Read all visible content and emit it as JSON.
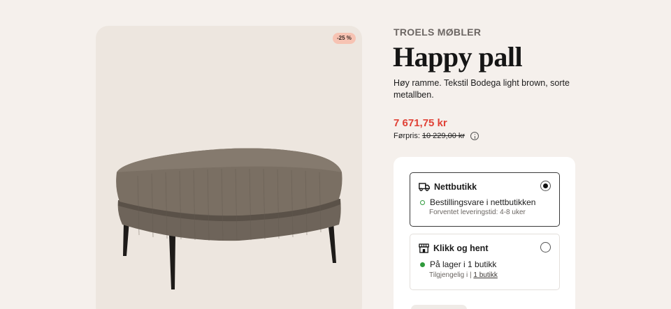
{
  "product": {
    "discount_badge": "-25 %",
    "brand": "TROELS MØBLER",
    "title": "Happy pall",
    "description": "Høy ramme. Tekstil Bodega light brown, sorte metallben.",
    "price": "7 671,75 kr",
    "prev_price_label": "Førpris:",
    "prev_price": "10 229,00 kr"
  },
  "delivery": {
    "online": {
      "label": "Nettbutikk",
      "status": "Bestillingsvare i nettbutikken",
      "sub": "Forventet leveringstid: 4-8 uker",
      "selected": true
    },
    "pickup": {
      "label": "Klikk og hent",
      "status": "På lager i 1 butikk",
      "sub_prefix": "Tilgjengelig i",
      "sub_link": "1 butikk",
      "selected": false
    }
  },
  "colors": {
    "price_red": "#e04136",
    "stock_green": "#2f9a3c",
    "badge_bg": "#f7c3b3"
  }
}
